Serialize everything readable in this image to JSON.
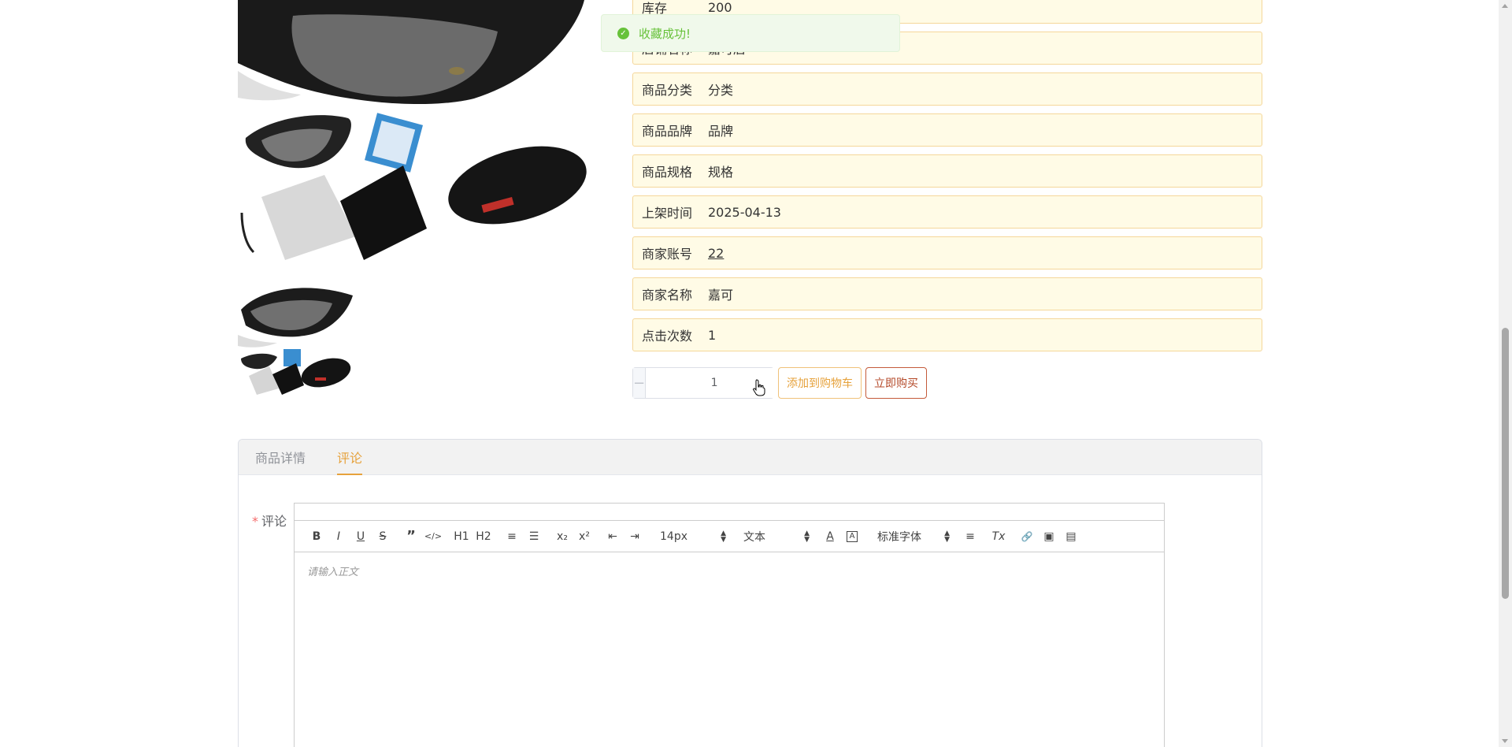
{
  "toast": {
    "message": "收藏成功!"
  },
  "info_rows": [
    {
      "label": "库存",
      "value": "200"
    },
    {
      "label": "店铺名称",
      "value": "嘉可店"
    },
    {
      "label": "商品分类",
      "value": "分类"
    },
    {
      "label": "商品品牌",
      "value": "品牌"
    },
    {
      "label": "商品规格",
      "value": "规格"
    },
    {
      "label": "上架时间",
      "value": "2025-04-13"
    },
    {
      "label": "商家账号",
      "value": "22"
    },
    {
      "label": "商家名称",
      "value": "嘉可"
    },
    {
      "label": "点击次数",
      "value": "1"
    }
  ],
  "quantity": {
    "minus": "−",
    "plus": "+",
    "value": "1"
  },
  "buttons": {
    "add_to_cart": "添加到购物车",
    "buy_now": "立即购买"
  },
  "tabs": [
    {
      "label": "商品详情",
      "active": false
    },
    {
      "label": "评论",
      "active": true
    }
  ],
  "comment_form": {
    "required_mark": "*",
    "label": "评论",
    "placeholder": "请输入正文",
    "font_size": "14px",
    "block_type": "文本",
    "font_family": "标准字体"
  },
  "toolbar_icons": {
    "bold": "B",
    "italic": "I",
    "underline": "U",
    "strike": "S",
    "quote": "”",
    "code": "</>",
    "h1": "H1",
    "h2": "H2",
    "ordered_list": "≡",
    "bullet_list": "☰",
    "subscript": "x₂",
    "superscript": "x²",
    "outdent": "⇤",
    "indent": "⇥",
    "font_color": "A",
    "background_color": "A",
    "align": "≡",
    "clean": "Tx",
    "link": "🔗",
    "image": "▣",
    "video": "▤"
  }
}
